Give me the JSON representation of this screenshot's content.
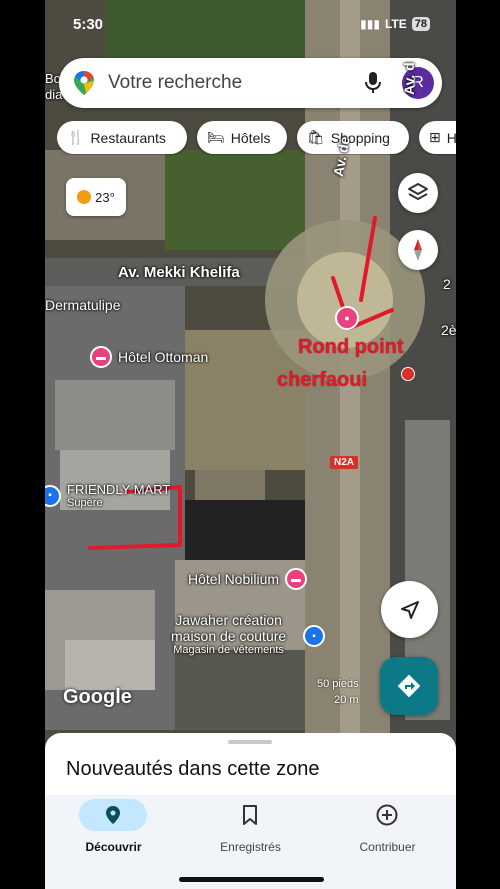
{
  "status": {
    "time": "5:30",
    "network": "LTE",
    "battery": "78"
  },
  "search": {
    "placeholder": "Votre recherche",
    "avatar_letter": "R"
  },
  "chips": [
    {
      "label": "Restaurants",
      "icon": "fork-knife-icon"
    },
    {
      "label": "Hôtels",
      "icon": "bed-icon"
    },
    {
      "label": "Shopping",
      "icon": "shopping-bag-icon"
    },
    {
      "label": "H",
      "icon": "plus-box-icon"
    }
  ],
  "weather": {
    "temp": "23°",
    "icon": "sun-icon"
  },
  "map": {
    "streets": {
      "mekki": "Av. Mekki Khelifa",
      "av_de": "Av. de",
      "av_d_right": "Av. d",
      "num_2": "2",
      "num_2e": "2è",
      "n2a": "N2A"
    },
    "labels": {
      "dermatulipe": "Dermatulipe",
      "hotel_ottoman": "Hôtel Ottoman",
      "friendly_mart": "FRIENDLY MART",
      "friendly_sub": "Supère",
      "hotel_nobilium": "Hôtel Nobilium",
      "jawaher_1": "Jawaher création",
      "jawaher_2": "maison de couture",
      "jawaher_3": "Magasin de vêtements",
      "top_left_1": "Bo",
      "top_left_2": "dia"
    },
    "annotation": {
      "line1": "Rond point",
      "line2": "cherfaoui"
    },
    "attribution": "Google",
    "scale": {
      "imperial": "50 pieds",
      "metric": "20 m"
    }
  },
  "sheet": {
    "title": "Nouveautés dans cette zone"
  },
  "nav": [
    {
      "label": "Découvrir",
      "icon": "location-pin-icon",
      "active": true
    },
    {
      "label": "Enregistrés",
      "icon": "bookmark-icon",
      "active": false
    },
    {
      "label": "Contribuer",
      "icon": "plus-circle-icon",
      "active": false
    }
  ],
  "colors": {
    "accent": "#0b7a86",
    "annotation_red": "#e01a2a",
    "poi_pink": "#e7417e",
    "active_tab": "#c2e7ff"
  }
}
